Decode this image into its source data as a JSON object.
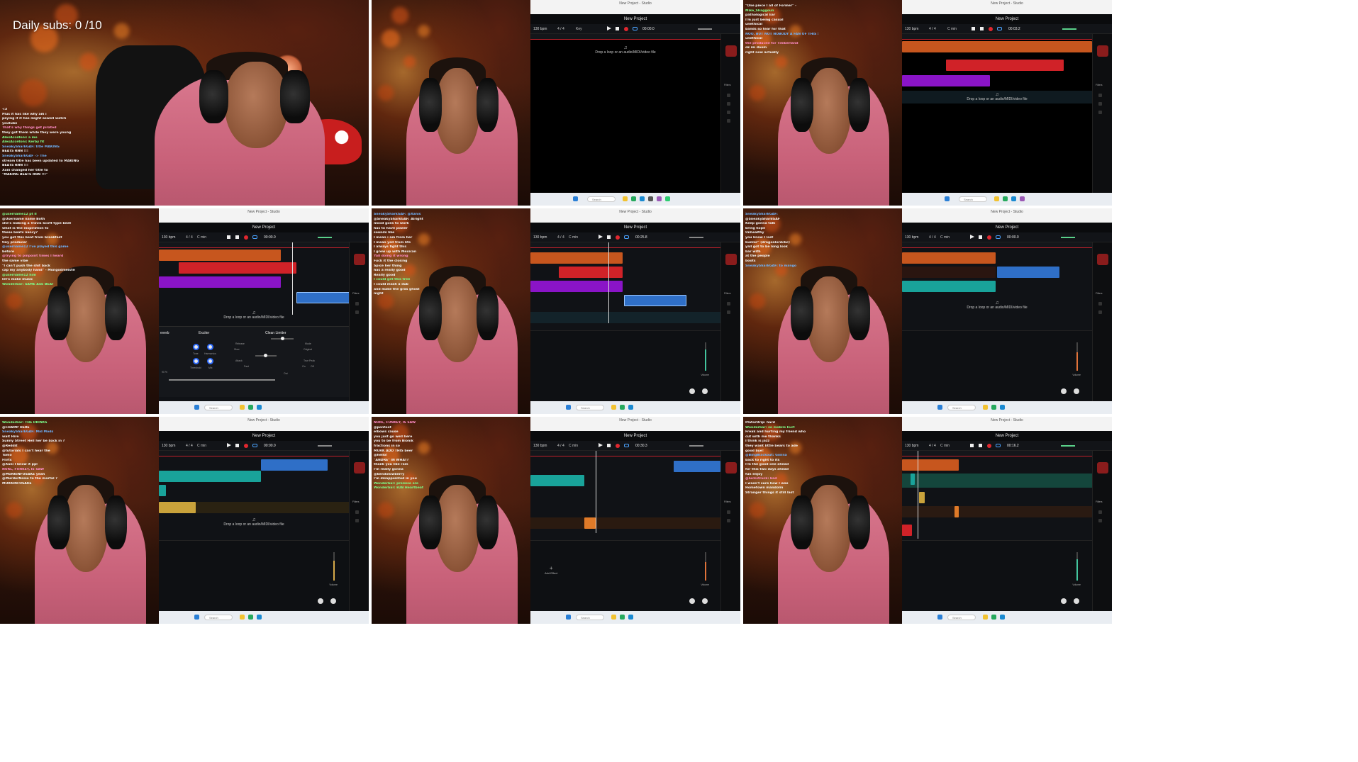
{
  "overlay": {
    "daily_subs": "Daily subs: 0 /10"
  },
  "daw": {
    "window_title": "New Project - Studio",
    "project_name": "New Project",
    "bpm": "130 bpm",
    "time_signature": "4 / 4",
    "key": "C min",
    "key_alt": "Key",
    "drop_hint": "Drop a loop or an audio/MIDI/video file",
    "sidebar_filters": "Filters",
    "add_effect": "Add Effect",
    "search_placeholder": "Search",
    "effects": {
      "exciter": "Exciter",
      "clean_limiter": "Clean Limiter",
      "reverb": "everb",
      "tone": "Tone",
      "harmonics": "Harmonics",
      "threshold": "Threshold",
      "mix": "Mix",
      "release": "Release",
      "attack": "Attack",
      "mode": "Mode",
      "mode_value": "Original",
      "true_peak": "True Peak",
      "on": "On",
      "off": "Off",
      "slow": "Slow",
      "fast": "Fast",
      "out": "Out",
      "percent": "90 %"
    },
    "mixer": {
      "volume": "Volume",
      "pan": "Pan",
      "reverb": "Reverb"
    }
  },
  "frames": [
    {
      "id": "f1",
      "time": "",
      "chat": [
        "<3",
        "Plus it has like why am i",
        "paying if it has might aswell watch",
        "youtube",
        "That's why things get pirated",
        "they got them while they were young",
        "AlexAccetoni: a me",
        "AlexAccetoni: Kerby fit",
        "SneakySharkGAF: title MAKING",
        "BEATS RNN !!!",
        "SneakySharkGAF -> The",
        "stream title has been updated to MAKING",
        "BEATS RNN !!!",
        "Xani changed her title to",
        "\"MAKING BEATS RNN !!!\""
      ]
    },
    {
      "id": "f2",
      "time": "00:00.0",
      "chat": []
    },
    {
      "id": "f3",
      "time": "00:03.2",
      "chat": [
        "\"One piece I all of Former\" -",
        "Mike_Shaggoun",
        "pathological liar",
        "I'm just being casual",
        "unethical",
        "bands so tear for that",
        "NOO, BUT NOT NOBODY A FAN OF THIS SO",
        "unethical",
        "the produced for Timberland",
        "ok im doom",
        "right now actually"
      ]
    },
    {
      "id": "f4",
      "time": "00:00.0",
      "chat": [
        "@username12 pt II",
        "@Username name Both",
        "she's making a Travis Scott type beat",
        "what is the inspiration to",
        "these beats nancy?",
        "you get this beat from breakfast",
        "tiny producer",
        "@username12 I've played this game",
        "before",
        "@trying to pinpoint times I heard",
        "the same vibe",
        "\"I can't push the shit back",
        "cap my anybody hand\" - Mongodmeister",
        "@username12 him",
        "let's make music",
        "Wonderbar: SAME ASS BEAT"
      ]
    },
    {
      "id": "f5",
      "time": "00:25.8",
      "chat": [
        "SneakySharkGAF: @Xanis",
        "@SneakySharkGAF: Alright",
        "mood goes to work",
        "has to have power",
        "sounds like",
        "I mean i am from her",
        "I mean yall from life",
        "I always fight this",
        "I grew up with Mexican",
        "Yall doing it wrong",
        "Fuck it the closing",
        "Spice her thing",
        "has a really good",
        "Really good",
        "I could get this tree",
        "I could mash a dub",
        "and make the gras ghost",
        "night"
      ]
    },
    {
      "id": "f6",
      "time": "00:00.0",
      "chat": [
        "SneakySharkGAF:",
        "@SneakySharkGAF",
        "Keep gonna talk",
        "bring hope",
        "Unhealthy",
        "you know I lost",
        "buzzer\" (dragonlordcbc)",
        "yall got to be long look",
        "bar with",
        "at the people",
        "boots",
        "SneakySharkGAF: to mango"
      ]
    },
    {
      "id": "f7",
      "time": "00:00.0",
      "chat": [
        "Wonderbar: THE DRINKS",
        "@CHAMP HERE",
        "SneakySharkGAF: Mid Mods",
        "wait Hire",
        "Sunny Street Hell her be back in ?",
        "@Reddit",
        "@tutorials I can't hear the",
        "Tomo",
        "Flirts",
        "@Xani I know it ppl",
        "NURL, FUNKEY, IS SAW",
        "@MURKINFOSAKE yeah",
        "@MurderNoise to the mortal ?",
        "MURKINFOSAKE"
      ]
    },
    {
      "id": "f8",
      "time": "00:30.3",
      "chat": [
        "NURL, FUNKEY, IS SAW",
        "@ponfoot",
        "elbows cause",
        "you just go well here",
        "you to be from Bionik",
        "fractions in so",
        "MURK ADD THIS beer",
        "@hello!",
        "\"ANDRE\" IN WHAT?",
        "thank you like rain",
        "I'm really gonna",
        "@kendolowberry",
        "I'm disappointed in you",
        "Wonderbar: premise are",
        "Wonderbar: B2B Heartbeat"
      ]
    },
    {
      "id": "f9",
      "time": "00:16.2",
      "chat": [
        "PlatorDrip: hard",
        "Wonderbar: so mobile hurt",
        "Freak and hurting my friend who",
        "cut with me thanks",
        "I think is jazz",
        "they want little bears to ade",
        "good bye!",
        "@BingBlackout: Gonna",
        "back to right to its",
        "I'm the good one ahead",
        "for this two days ahead",
        "fun enjoy",
        "@luckstruck: bad",
        "I wasn't sure how I was",
        "Hometown mandolin",
        "Stranger things it still last"
      ]
    }
  ]
}
